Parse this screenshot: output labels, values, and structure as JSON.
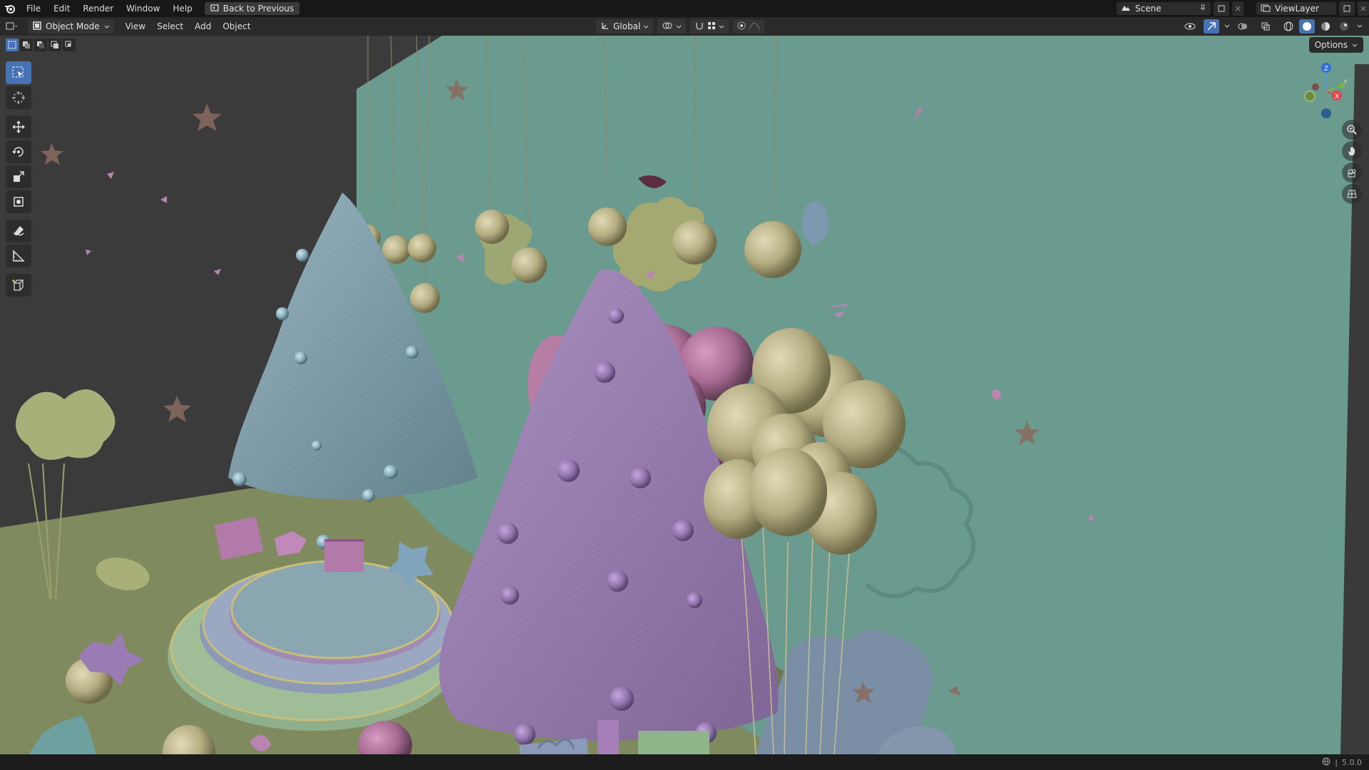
{
  "menu": {
    "items": [
      "File",
      "Edit",
      "Render",
      "Window",
      "Help"
    ],
    "back_button": "Back to Previous"
  },
  "top_right": {
    "scene_name": "Scene",
    "view_layer": "ViewLayer"
  },
  "header": {
    "mode": "Object Mode",
    "menus": [
      "View",
      "Select",
      "Add",
      "Object"
    ],
    "transform_orientation": "Global"
  },
  "viewport": {
    "options_label": "Options",
    "gizmo_axes": {
      "z": "Z",
      "y": "Y",
      "x": "X"
    },
    "colors": {
      "wall_left": "#3a3a3a",
      "wall_back": "#6b9a8e",
      "floor": "#7f8a5e",
      "tree_blue": "#7a9aa6",
      "tree_purple": "#9a7eb0",
      "balloon_gold": "#b8aa85",
      "balloon_pink": "#a86b93",
      "ornament_gold": "#b4ad82"
    }
  },
  "toolbar": {
    "tools": [
      "select-box",
      "cursor",
      "move",
      "rotate",
      "scale",
      "transform",
      "annotate",
      "measure",
      "add-cube"
    ]
  },
  "status": {
    "version": "5.0.0"
  },
  "theme": {
    "accent": "#4772b3"
  }
}
